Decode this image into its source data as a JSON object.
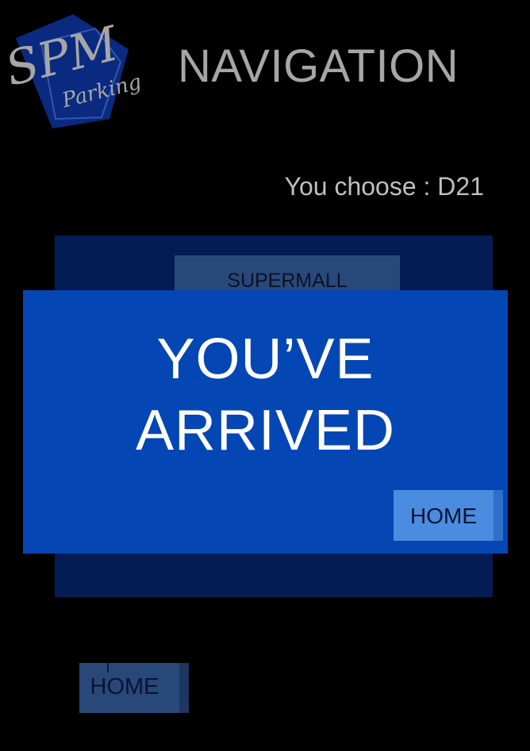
{
  "logo": {
    "brand": "SPM",
    "subtext": "Parking",
    "colors": {
      "badge": "#0a2a80",
      "outline": "#3157b0",
      "text": "#a6a6a6"
    }
  },
  "header": {
    "title": "NAVIGATION"
  },
  "selection": {
    "text": "You choose : D21"
  },
  "map": {
    "store_label": "SUPERMALL"
  },
  "arrival_dialog": {
    "heading_line1": "YOU’VE",
    "heading_line2": "ARRIVED",
    "home_label": "HOME"
  },
  "footer": {
    "home_label": "HOME"
  },
  "colors": {
    "background": "#000000",
    "panel": "#031c54",
    "dialog": "#0446b4",
    "button_light": "#4a8ce0",
    "button_dark": "#29487a",
    "title_gray": "#a6a6a6"
  }
}
